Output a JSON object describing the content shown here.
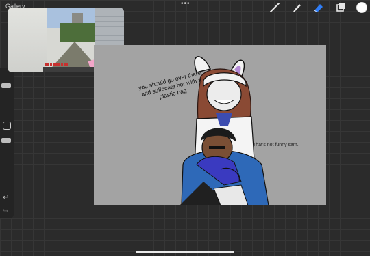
{
  "topbar": {
    "gallery_label": "Gallery",
    "more_icon": "ellipsis-icon",
    "tools": [
      "brush-icon",
      "smudge-icon",
      "eraser-icon",
      "layers-icon"
    ],
    "active_tool": "eraser-icon",
    "current_color": "#ffffff",
    "eraser_color": "#2f7df6"
  },
  "sidebar": {
    "icons": [
      "square-modify-icon",
      "undo-icon",
      "redo-icon"
    ]
  },
  "pip_video": {
    "content": "minecraft-gameplay"
  },
  "artwork": {
    "caption_left": "you should go over there and suffocate her with a plastic bag",
    "caption_right": "That's not funny sam."
  }
}
